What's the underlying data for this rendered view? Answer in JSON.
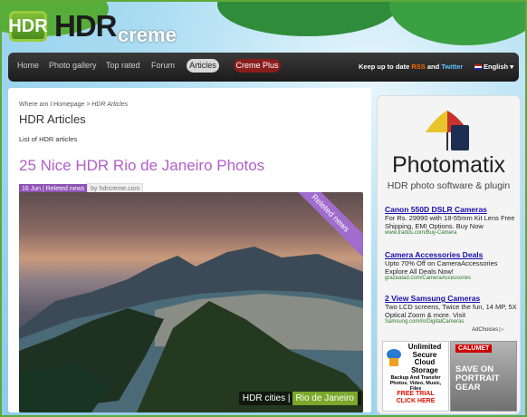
{
  "brand": {
    "logo_mark": "HDR",
    "name": "HDR",
    "suffix": "creme"
  },
  "nav": {
    "items": [
      "Home",
      "Photo gallery",
      "Top rated",
      "Forum"
    ],
    "active": "Articles",
    "special": "Creme Plus",
    "updates_prefix": "Keep up to date",
    "rss": "RSS",
    "and": "and",
    "twitter": "Twitter",
    "language": "English"
  },
  "breadcrumb": {
    "prefix": "Where am I:",
    "home": "Homepage",
    "current": "HDR Articles"
  },
  "page": {
    "title": "HDR Articles",
    "subtitle": "List of HDR articles"
  },
  "post": {
    "title": "25 Nice HDR Rio de Janeiro Photos",
    "meta_tag": "16 Jun | Releted news",
    "meta_by": "by hdrcreme.com",
    "ribbon": "Releted news",
    "caption_category": "HDR cities",
    "caption_sep": "|",
    "caption_location": "Rio de Janeiro"
  },
  "sidebar": {
    "photomatix": {
      "title": "Photomatix",
      "subtitle": "HDR photo software & plugin"
    },
    "ads": [
      {
        "title": "Canon 550D DSLR Cameras",
        "body": "For Rs. 29990 with 18-55mm Kit Lens Free Shipping, EMI Options. Buy Now",
        "url": "www.tradus.com/Buy-Camera"
      },
      {
        "title": "Camera Accessories Deals",
        "body": "Upto 70% Off on CameraAccessories Explore All Deals Now!",
        "url": "grazeatad.com/CameraAccessories"
      },
      {
        "title": "2 View Samsung Cameras",
        "body": "Two LCD screens, Twice the fun, 14 MP, 5X Optical Zoom & more. Visit",
        "url": "Samsung.com/in/DigitalCameras"
      }
    ],
    "adchoices": "AdChoices ▷",
    "banner_cloud": {
      "title": "Unlimited Secure Cloud Storage",
      "sub": "Backup And Transfer Photos, Video, Music, Files",
      "cta": "FREE TRIAL CLICK HERE"
    },
    "banner_calumet": {
      "brand": "CALUMET",
      "text": "SAVE ON PORTRAIT GEAR"
    }
  }
}
